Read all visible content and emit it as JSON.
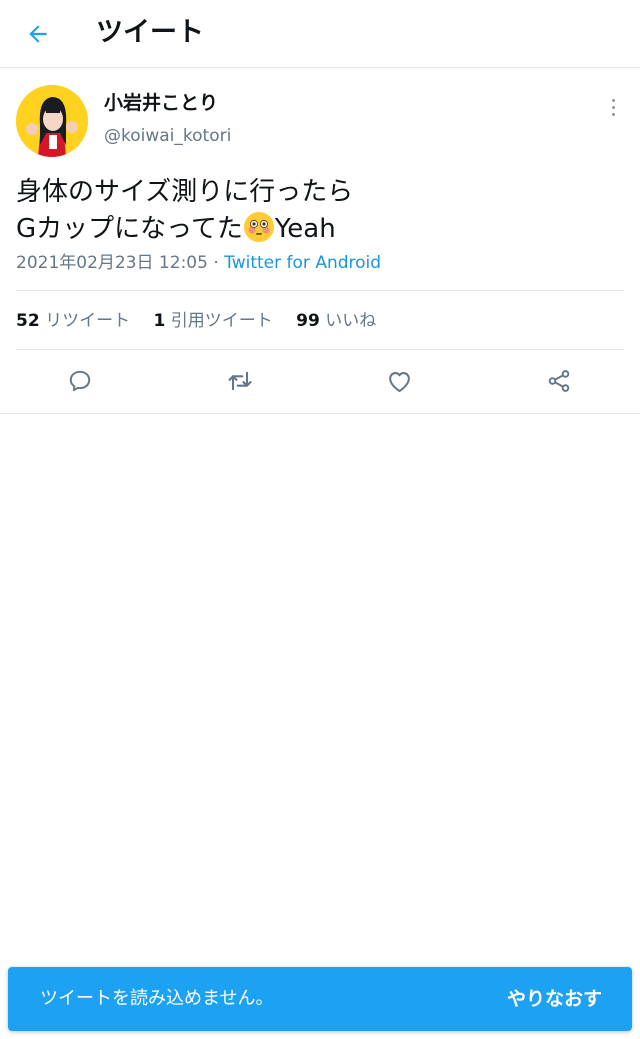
{
  "header": {
    "title": "ツイート",
    "back_icon": "arrow-left-icon"
  },
  "tweet": {
    "author_name": "小岩井ことり",
    "author_handle": "@koiwai_kotori",
    "text_line1": "身体のサイズ測りに行ったら",
    "text_line2_prefix": "Gカップになってた",
    "text_line2_suffix": "Yeah",
    "emoji": "flushed-face-emoji",
    "timestamp": "2021年02月23日 12:05",
    "separator": " · ",
    "source": "Twitter for Android"
  },
  "stats": {
    "retweets_count": "52",
    "retweets_label": "リツイート",
    "quotes_count": "1",
    "quotes_label": "引用ツイート",
    "likes_count": "99",
    "likes_label": "いいね"
  },
  "actions": [
    "reply-icon",
    "retweet-icon",
    "like-icon",
    "share-icon"
  ],
  "toast": {
    "message": "ツイートを読み込めません。",
    "retry_label": "やりなおす"
  },
  "colors": {
    "accent": "#1da1f2",
    "link": "#1b95e0",
    "secondary_text": "#657786",
    "divider": "#e1e8ed"
  }
}
